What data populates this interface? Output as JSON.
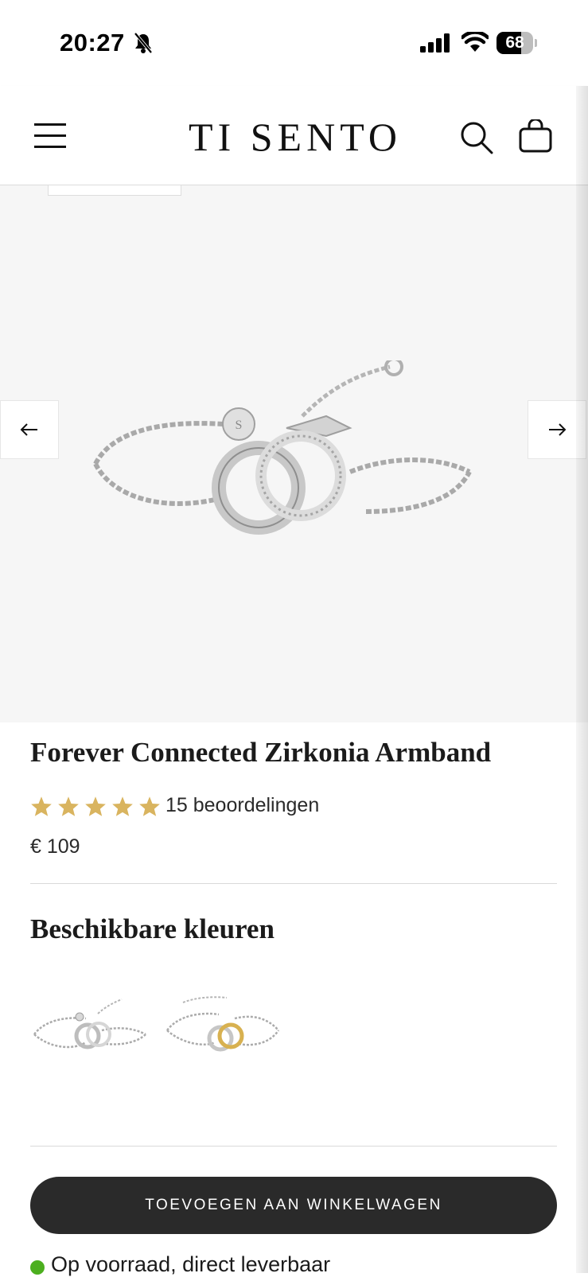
{
  "status_bar": {
    "time": "20:27",
    "battery_level": "68",
    "battery_fraction": 0.68,
    "icons": [
      "bell-slash-icon",
      "cellular-signal-icon",
      "wifi-icon",
      "battery-icon"
    ]
  },
  "header": {
    "logo": "TI SENTO",
    "icons": [
      "hamburger-menu-icon",
      "search-icon",
      "shopping-bag-icon"
    ]
  },
  "gallery": {
    "prev_icon": "arrow-left-icon",
    "next_icon": "arrow-right-icon"
  },
  "product": {
    "title": "Forever Connected Zirkonia Armband",
    "rating_stars": 5,
    "reviews": "15 beoordelingen",
    "price": "€ 109"
  },
  "colors": {
    "heading": "Beschikbare kleuren",
    "options": [
      "silver",
      "silver-gold"
    ]
  },
  "cta": {
    "add_to_cart": "TOEVOEGEN AAN WINKELWAGEN"
  },
  "stock": {
    "text": "Op voorraad, direct leverbaar"
  },
  "colors_ui": {
    "star": "#d9b45f",
    "button": "#2a2a2a",
    "stock_dot": "#4caf1f",
    "gallery_bg": "#f6f6f6"
  }
}
